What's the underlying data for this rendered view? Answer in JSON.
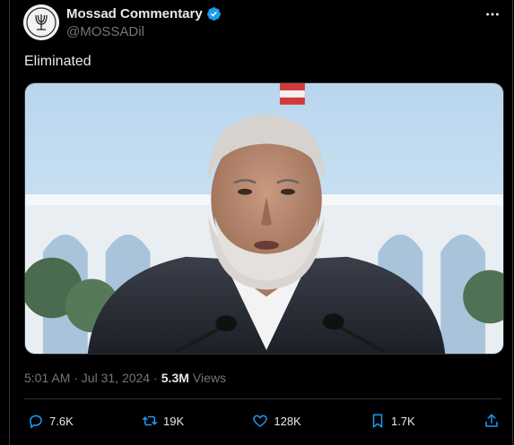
{
  "post": {
    "author_name": "Mossad Commentary",
    "handle": "@MOSSADil",
    "text": "Eliminated",
    "timestamp": "5:01 AM · Jul 31, 2024",
    "separator": "·",
    "views_count": "5.3M",
    "views_label": "Views"
  },
  "actions": {
    "replies": "7.6K",
    "reposts": "19K",
    "likes": "128K",
    "bookmarks": "1.7K"
  },
  "icons": {
    "verified": "verified-badge-icon",
    "more": "more-icon",
    "reply": "reply-icon",
    "repost": "repost-icon",
    "like": "heart-icon",
    "bookmark": "bookmark-icon",
    "share": "share-icon"
  },
  "colors": {
    "accent": "#1d9bf0",
    "background": "#000000",
    "text": "#e7e9ea",
    "muted": "#71767b",
    "verified": "#1d9bf0"
  }
}
